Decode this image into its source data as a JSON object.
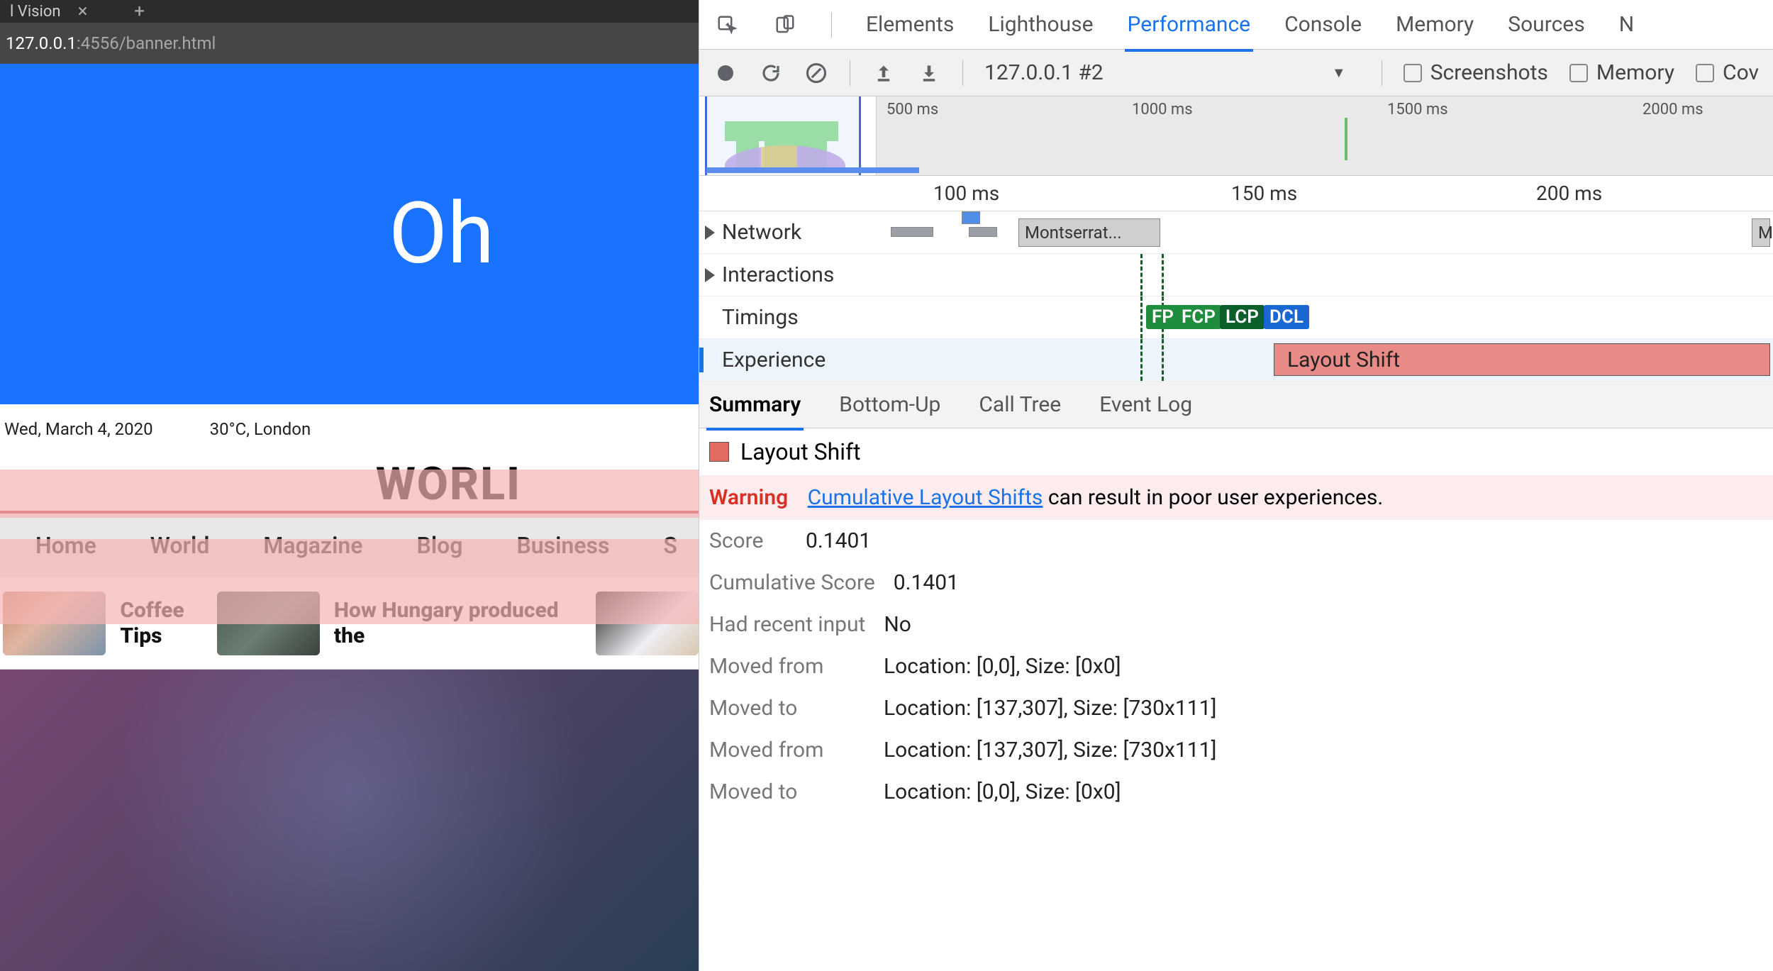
{
  "browser": {
    "tab_label": "l Vision",
    "url_host": "127.0.0.1",
    "url_path": ":4556/banner.html"
  },
  "page": {
    "banner_text": "Oh",
    "date": "Wed, March 4, 2020",
    "weather": "30°C, London",
    "title": "WORLI",
    "nav": [
      "Home",
      "World",
      "Magazine",
      "Blog",
      "Business",
      "S"
    ],
    "strip": [
      {
        "headline": "Coffee Tips"
      },
      {
        "headline": "How Hungary produced the"
      }
    ]
  },
  "devtools": {
    "select_icon": "select",
    "panels": [
      "Elements",
      "Lighthouse",
      "Performance",
      "Console",
      "Memory",
      "Sources",
      "N"
    ],
    "panels_active": "Performance",
    "toolbar": {
      "record": "record",
      "reload": "reload",
      "clear": "clear",
      "up": "upload",
      "down": "download",
      "select_label": "127.0.0.1 #2",
      "chk": [
        "Screenshots",
        "Memory",
        "Cov"
      ]
    },
    "overview_ticks": [
      "500 ms",
      "1000 ms",
      "1500 ms",
      "2000 ms"
    ],
    "flame_ticks": [
      "100 ms",
      "150 ms",
      "200 ms"
    ],
    "tracks": {
      "network": "Network",
      "interactions": "Interactions",
      "timings": "Timings",
      "experience": "Experience",
      "net_item": "Montserrat...",
      "net_item_end": "M",
      "timing_pills": [
        "FP",
        "FCP",
        "LCP",
        "DCL"
      ],
      "layout_shift": "Layout Shift"
    },
    "subtabs": [
      "Summary",
      "Bottom-Up",
      "Call Tree",
      "Event Log"
    ],
    "details": {
      "title": "Layout Shift",
      "warning_label": "Warning",
      "warning_link": "Cumulative Layout Shifts",
      "warning_rest": " can result in poor user experiences.",
      "rows": [
        {
          "k": "Score",
          "v": "0.1401",
          "narrow": true
        },
        {
          "k": "Cumulative Score",
          "v": "0.1401"
        },
        {
          "k": "Had recent input",
          "v": "No"
        },
        {
          "k": "Moved from",
          "v": "Location: [0,0], Size: [0x0]"
        },
        {
          "k": "Moved to",
          "v": "Location: [137,307], Size: [730x111]"
        },
        {
          "k": "Moved from",
          "v": "Location: [137,307], Size: [730x111]"
        },
        {
          "k": "Moved to",
          "v": "Location: [0,0], Size: [0x0]"
        }
      ]
    }
  }
}
